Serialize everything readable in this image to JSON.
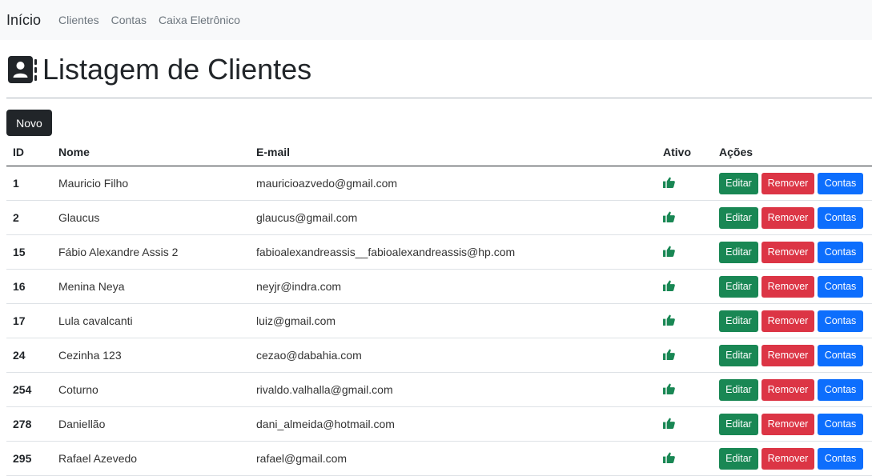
{
  "navbar": {
    "brand": "Início",
    "links": [
      "Clientes",
      "Contas",
      "Caixa Eletrônico"
    ]
  },
  "page": {
    "title": "Listagem de Clientes",
    "icon": "address-book-icon",
    "new_button": "Novo"
  },
  "table": {
    "headers": {
      "id": "ID",
      "name": "Nome",
      "email": "E-mail",
      "active": "Ativo",
      "actions": "Ações"
    },
    "action_labels": {
      "edit": "Editar",
      "remove": "Remover",
      "accounts": "Contas"
    },
    "active_icon": "thumbs-up-icon",
    "rows": [
      {
        "id": "1",
        "name": "Mauricio Filho",
        "email": "mauricioazvedo@gmail.com"
      },
      {
        "id": "2",
        "name": "Glaucus",
        "email": "glaucus@gmail.com"
      },
      {
        "id": "15",
        "name": "Fábio Alexandre Assis 2",
        "email": "fabioalexandreassis__fabioalexandreassis@hp.com"
      },
      {
        "id": "16",
        "name": "Menina Neya",
        "email": "neyjr@indra.com"
      },
      {
        "id": "17",
        "name": "Lula cavalcanti",
        "email": "luiz@gmail.com"
      },
      {
        "id": "24",
        "name": "Cezinha 123",
        "email": "cezao@dabahia.com"
      },
      {
        "id": "254",
        "name": "Coturno",
        "email": "rivaldo.valhalla@gmail.com"
      },
      {
        "id": "278",
        "name": "Daniellão",
        "email": "dani_almeida@hotmail.com"
      },
      {
        "id": "295",
        "name": "Rafael Azevedo",
        "email": "rafael@gmail.com"
      }
    ]
  },
  "colors": {
    "edit": "#198754",
    "remove": "#dc3545",
    "accounts": "#0d6efd",
    "dark": "#212529",
    "thumb": "#198754",
    "navbar_bg": "#f8f9fa"
  }
}
